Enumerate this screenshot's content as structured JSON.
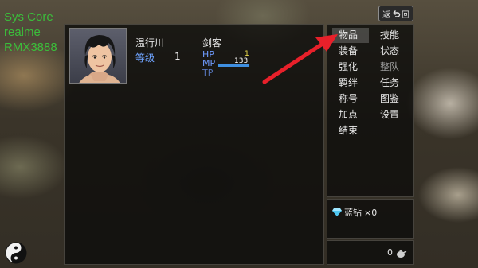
{
  "debug_overlay": {
    "line1": "Sys Core",
    "line2": "realme",
    "line3": "RMX3888"
  },
  "return_button": {
    "label_left": "返",
    "label_right": "回"
  },
  "character": {
    "name": "温行川",
    "class": "剑客",
    "level_label": "等级",
    "level": "1",
    "hp_label": "HP",
    "hp_value": "1",
    "mp_label": "MP",
    "mp_value": "133",
    "mp_fill_fraction": 0.95,
    "tp_label": "TP"
  },
  "menu": {
    "items": [
      {
        "label": "物品",
        "selected": true,
        "enabled": true
      },
      {
        "label": "技能",
        "selected": false,
        "enabled": true
      },
      {
        "label": "装备",
        "selected": false,
        "enabled": true
      },
      {
        "label": "状态",
        "selected": false,
        "enabled": true
      },
      {
        "label": "强化",
        "selected": false,
        "enabled": true
      },
      {
        "label": "整队",
        "selected": false,
        "enabled": false
      },
      {
        "label": "羁绊",
        "selected": false,
        "enabled": true
      },
      {
        "label": "任务",
        "selected": false,
        "enabled": true
      },
      {
        "label": "称号",
        "selected": false,
        "enabled": true
      },
      {
        "label": "图鉴",
        "selected": false,
        "enabled": true
      },
      {
        "label": "加点",
        "selected": false,
        "enabled": true
      },
      {
        "label": "设置",
        "selected": false,
        "enabled": true
      },
      {
        "label": "结束",
        "selected": false,
        "enabled": true
      }
    ]
  },
  "currency": {
    "gem_icon": "blue-diamond-icon",
    "gem_label": "蓝钻",
    "gem_amount": "×0",
    "money_amount": "0",
    "money_icon": "coin-pouch-icon"
  },
  "colors": {
    "accent_red_arrow": "#e8202a",
    "label_blue": "#6fa4ff",
    "hp_yellow": "#f2e24e",
    "mp_bar": "#3f8fe0",
    "debug_green": "#3bbd3b"
  }
}
